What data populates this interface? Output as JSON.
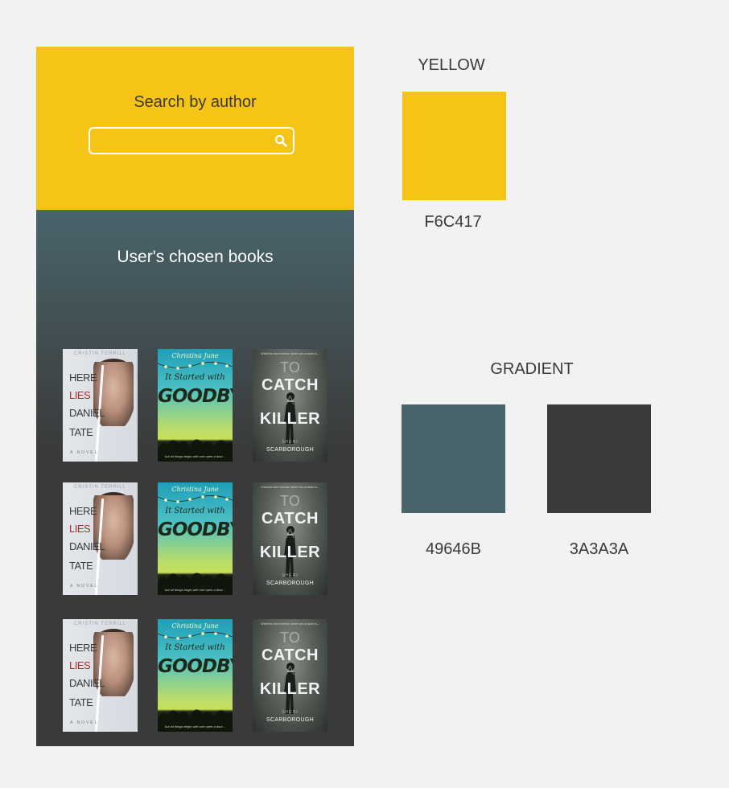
{
  "search": {
    "label": "Search by author",
    "value": "",
    "placeholder": ""
  },
  "books": {
    "title": "User's chosen books",
    "cover1": {
      "author": "CRISTIN TERRILL",
      "line1": "HERE",
      "line2": "LIES",
      "line3": "DANIEL",
      "line4": "TATE",
      "sub": "A NOVEL"
    },
    "cover2": {
      "author": "Christina June",
      "line1": "It Started with",
      "line2": "GOODBYE",
      "tag": "but all things begin with one open a door..."
    },
    "cover3": {
      "top": "What this teen forensic sleuth has at stake is...",
      "line1": "TO",
      "line2": "CATCH",
      "line3": "A",
      "line4": "KILLER",
      "author1": "SHERI",
      "author2": "SCARBOROUGH"
    }
  },
  "guide": {
    "yellow": {
      "heading": "YELLOW",
      "color": "#F6C417",
      "code": "F6C417"
    },
    "gradient": {
      "heading": "GRADIENT",
      "start_color": "#49646B",
      "start_code": "49646B",
      "end_color": "#3A3A3A",
      "end_code": "3A3A3A"
    }
  },
  "icons": {
    "search": "search-icon"
  }
}
